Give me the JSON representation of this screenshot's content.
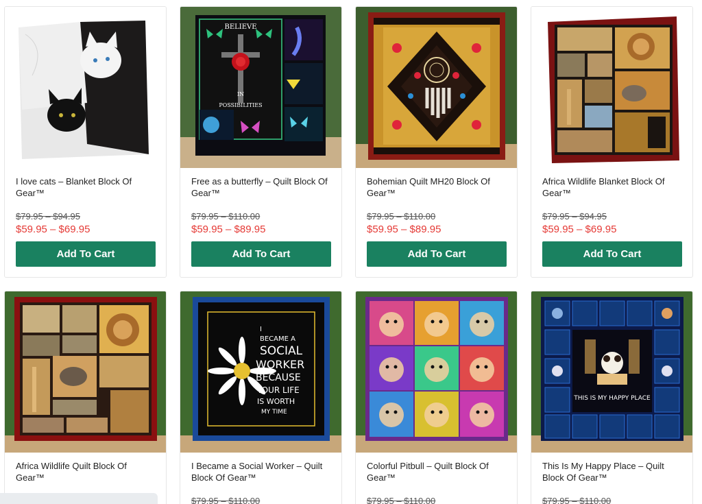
{
  "products": [
    {
      "title": "I love cats – Blanket Block Of Gear™",
      "old_price": "$79.95 – $94.95",
      "new_price": "$59.95 – $69.95",
      "button": "Add To Cart",
      "image": "cats-blanket"
    },
    {
      "title": "Free as a butterfly – Quilt Block Of Gear™",
      "old_price": "$79.95 – $110.00",
      "new_price": "$59.95 – $89.95",
      "button": "Add To Cart",
      "image": "butterfly-quilt"
    },
    {
      "title": "Bohemian Quilt MH20 Block Of Gear™",
      "old_price": "$79.95 – $110.00",
      "new_price": "$59.95 – $89.95",
      "button": "Add To Cart",
      "image": "bohemian-quilt"
    },
    {
      "title": "Africa Wildlife Blanket Block Of Gear™",
      "old_price": "$79.95 – $94.95",
      "new_price": "$59.95 – $69.95",
      "button": "Add To Cart",
      "image": "africa-blanket"
    },
    {
      "title": "Africa Wildlife Quilt Block Of Gear™",
      "image": "africa-quilt"
    },
    {
      "title": "I Became a Social Worker – Quilt Block Of Gear™",
      "old_price": "$79.95 – $110.00",
      "image": "social-worker-quilt"
    },
    {
      "title": "Colorful Pitbull – Quilt Block Of Gear™",
      "old_price": "$79.95 – $110.00",
      "image": "pitbull-quilt"
    },
    {
      "title": "This Is My Happy Place – Quilt Block Of Gear™",
      "old_price": "$79.95 – $110.00",
      "image": "happy-place-quilt"
    }
  ],
  "image_text": {
    "butterfly": [
      "BELIEVE",
      "IN",
      "POSSIBILITIES"
    ],
    "social_worker": [
      "I",
      "BECAME A",
      "SOCIAL",
      "WORKER",
      "BECAUSE",
      "YOUR LIFE",
      "IS WORTH",
      "MY TIME"
    ],
    "happy_place": "THIS IS MY HAPPY PLACE"
  },
  "colors": {
    "button": "#1a8160",
    "sale_price": "#e53935",
    "border": "#e6e6e6"
  }
}
